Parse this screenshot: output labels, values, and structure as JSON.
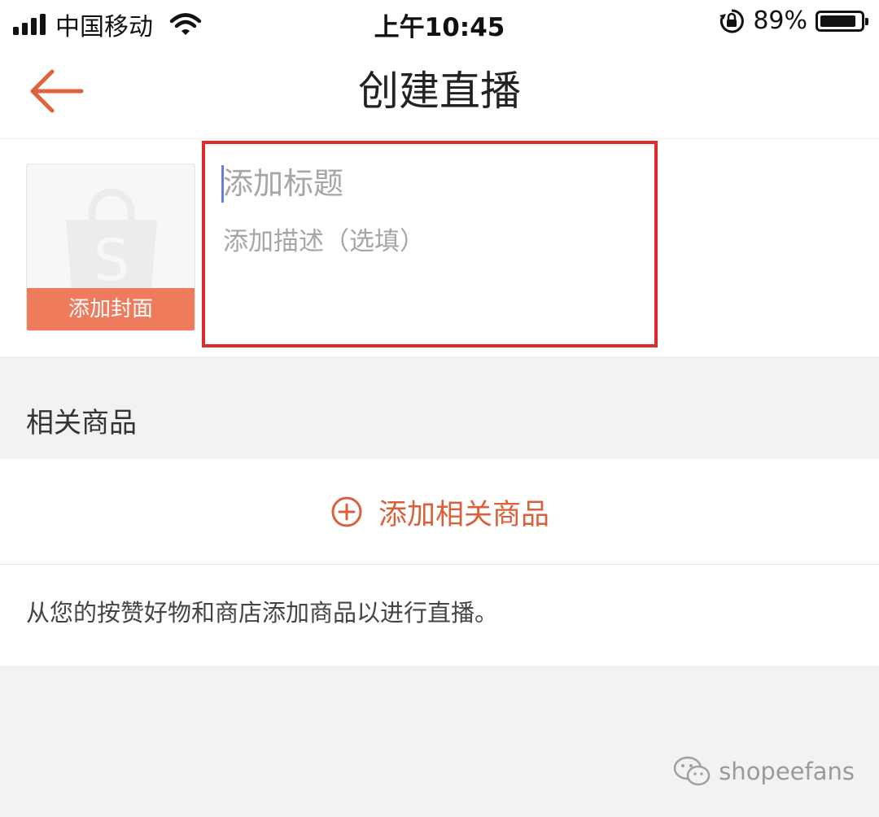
{
  "status_bar": {
    "carrier": "中国移动",
    "time": "上午10:45",
    "battery_percent_text": "89%",
    "battery_level": 0.89
  },
  "navbar": {
    "title": "创建直播",
    "back_icon": "arrow-left-icon",
    "accent_color": "#e0623c"
  },
  "cover": {
    "label": "添加封面",
    "icon": "shopping-bag-icon"
  },
  "form": {
    "title_placeholder": "添加标题",
    "description_placeholder": "添加描述（选填）",
    "highlight_color": "#e02a2a"
  },
  "related": {
    "section_title": "相关商品",
    "add_button_label": "添加相关商品",
    "add_icon": "plus-circle-icon",
    "helper_text": "从您的按赞好物和商店添加商品以进行直播。"
  },
  "watermark": {
    "text": "shopeefans",
    "icon": "wechat-icon"
  }
}
